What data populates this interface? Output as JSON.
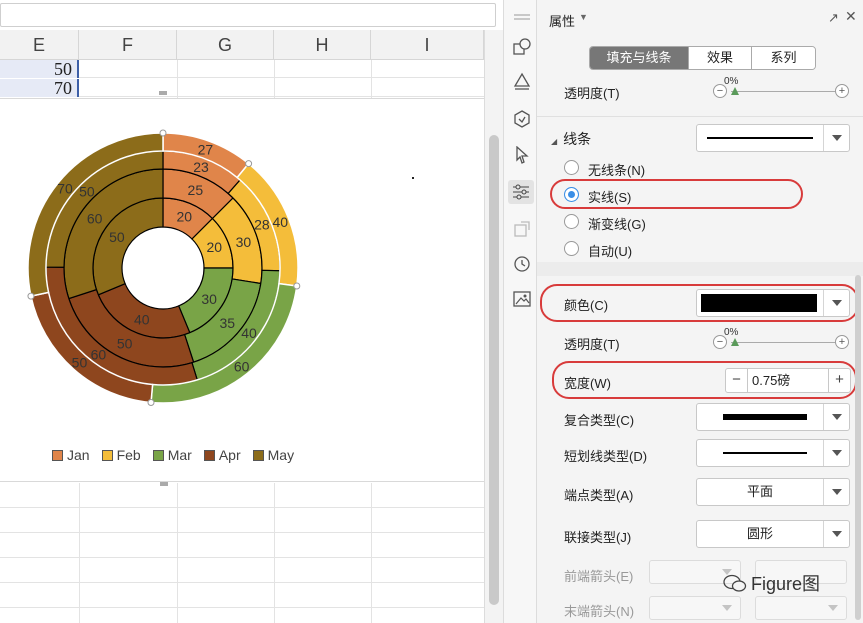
{
  "sheet": {
    "columns": [
      "E",
      "F",
      "G",
      "H",
      "I"
    ],
    "rows": [
      {
        "value": "50"
      },
      {
        "value": "70"
      }
    ]
  },
  "chart_data": {
    "type": "doughnut",
    "legend": [
      "Jan",
      "Feb",
      "Mar",
      "Apr",
      "May"
    ],
    "colors": {
      "Jan": "#e0854a",
      "Feb": "#f4bd3a",
      "Mar": "#79a447",
      "Apr": "#8e461e",
      "May": "#8c6c1a"
    },
    "rings": [
      {
        "ring": "inner",
        "values": {
          "Jan": 20,
          "Feb": 20,
          "Mar": 30,
          "Apr": 40,
          "May": 50
        }
      },
      {
        "ring": "second",
        "values": {
          "Jan": 25,
          "Feb": 30,
          "Mar": 35,
          "Apr": 50,
          "May": 60
        }
      },
      {
        "ring": "third",
        "values": {
          "Jan": 23,
          "Feb": 28,
          "Mar": 40,
          "Apr": 60,
          "May": 50
        }
      },
      {
        "ring": "outer",
        "values": {
          "Jan": 27,
          "Feb": 40,
          "Mar": 60,
          "Apr": 50,
          "May": 70
        }
      }
    ],
    "label_positions": "inside",
    "grid": false
  },
  "panel": {
    "title": "属性",
    "tabs": [
      {
        "label": "填充与线条",
        "active": true
      },
      {
        "label": "效果",
        "active": false
      },
      {
        "label": "系列",
        "active": false
      }
    ],
    "fill_transparency_label": "透明度(T)",
    "fill_transparency_value": "0%",
    "line_section": "线条",
    "line_options": [
      {
        "label": "无线条(N)",
        "checked": false
      },
      {
        "label": "实线(S)",
        "checked": true
      },
      {
        "label": "渐变线(G)",
        "checked": false
      },
      {
        "label": "自动(U)",
        "checked": false
      }
    ],
    "color_label": "颜色(C)",
    "color_value": "#000000",
    "line_transparency_label": "透明度(T)",
    "line_transparency_value": "0%",
    "width_label": "宽度(W)",
    "width_value": "0.75磅",
    "compound_label": "复合类型(C)",
    "dash_label": "短划线类型(D)",
    "cap_label": "端点类型(A)",
    "cap_value": "平面",
    "join_label": "联接类型(J)",
    "join_value": "圆形",
    "begin_arrow_label": "前端箭头(E)",
    "end_arrow_label": "末端箭头(N)"
  },
  "watermark": "Figure图",
  "icons": [
    "hamburger-icon",
    "shapes-icon",
    "fill-icon",
    "effects-icon",
    "cursor-icon",
    "properties-icon",
    "transform-icon",
    "history-icon",
    "image-icon"
  ]
}
